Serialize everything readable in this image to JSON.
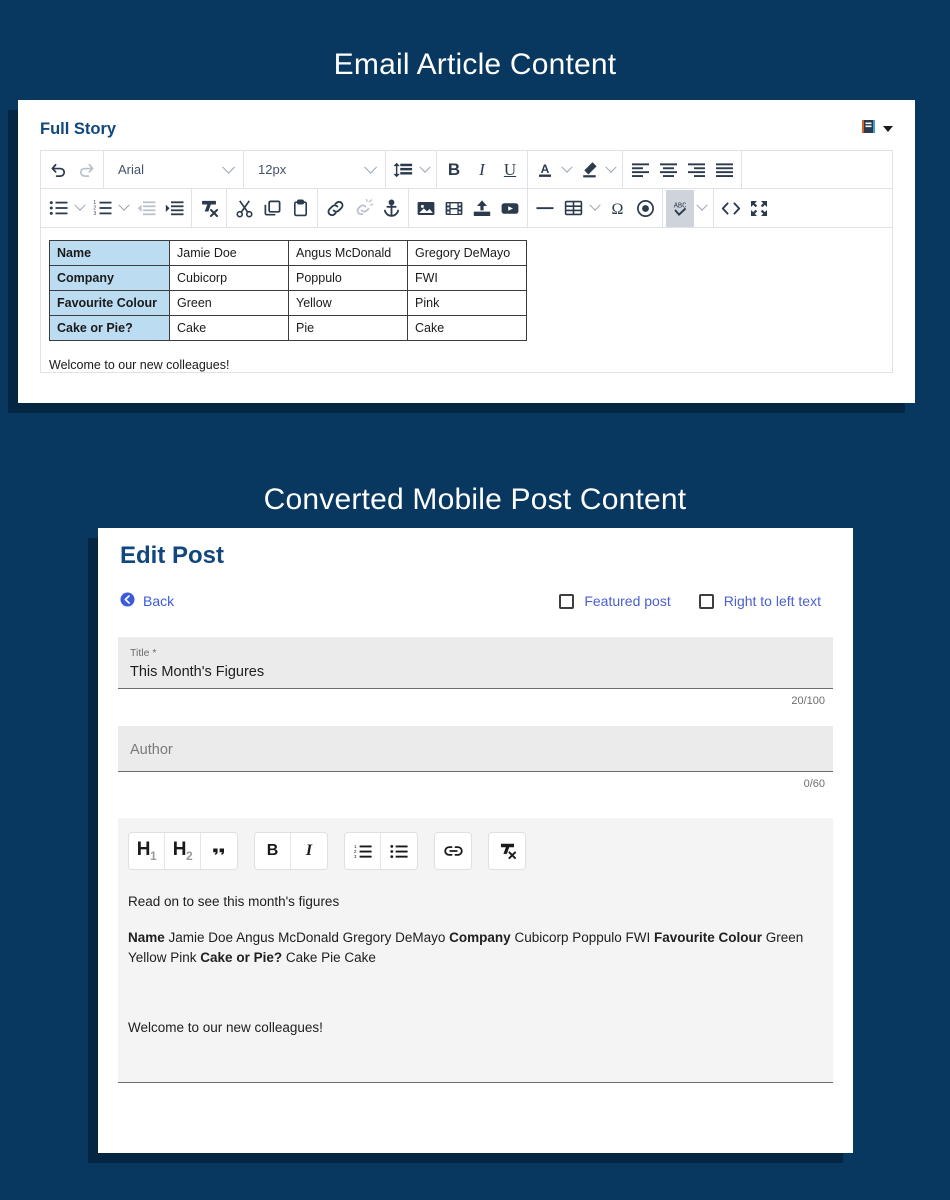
{
  "page": {
    "background_color": "#083760",
    "heading_email": "Email Article Content",
    "heading_mobile": "Converted Mobile Post Content"
  },
  "email_editor": {
    "panel_title": "Full Story",
    "header_menu_icon": "article-menu-icon",
    "toolbar_row1": {
      "undo": "undo-icon",
      "redo": "redo-icon",
      "font_family_value": "Arial",
      "font_size_value": "12px",
      "line_height": "line-height-icon",
      "bold": "B",
      "italic": "I",
      "underline": "U",
      "text_color": "A",
      "highlight": "highlight-pen-icon",
      "align_left": "align-left-icon",
      "align_center": "align-center-icon",
      "align_right": "align-right-icon",
      "align_justify": "align-justify-icon"
    },
    "toolbar_row2": {
      "bullet_list": "bullet-list-icon",
      "numbered_list": "numbered-list-icon",
      "outdent": "outdent-icon",
      "indent": "indent-icon",
      "clear_formatting": "clear-formatting-icon",
      "cut": "scissors-icon",
      "copy": "copy-icon",
      "paste": "paste-icon",
      "insert_link": "link-icon",
      "unlink": "unlink-icon",
      "anchor": "anchor-icon",
      "image": "image-icon",
      "video": "film-icon",
      "upload": "upload-icon",
      "youtube": "youtube-icon",
      "horizontal_rule": "horizontal-rule-icon",
      "table": "table-icon",
      "special_character": "omega-icon",
      "target": "target-icon",
      "spellcheck": "spellcheck-icon",
      "source_code": "code-icon",
      "fullscreen": "fullscreen-icon"
    },
    "content": {
      "table": {
        "rows": [
          {
            "header": "Name",
            "cells": [
              "Jamie Doe",
              "Angus McDonald",
              "Gregory DeMayo"
            ]
          },
          {
            "header": "Company",
            "cells": [
              "Cubicorp",
              "Poppulo",
              "FWI"
            ]
          },
          {
            "header": "Favourite Colour",
            "cells": [
              "Green",
              "Yellow",
              "Pink"
            ]
          },
          {
            "header": "Cake or Pie?",
            "cells": [
              "Cake",
              "Pie",
              "Cake"
            ]
          }
        ],
        "header_cell_color": "#bcdcf2"
      },
      "paragraph": "Welcome to our new colleagues!"
    }
  },
  "mobile_post": {
    "page_title": "Edit Post",
    "back_label": "Back",
    "back_icon": "back-arrow-icon",
    "checkboxes": [
      {
        "label": "Featured post",
        "checked": false
      },
      {
        "label": "Right to left text",
        "checked": false
      }
    ],
    "title_field": {
      "label": "Title *",
      "value": "This Month's Figures",
      "counter": "20/100"
    },
    "author_field": {
      "placeholder": "Author",
      "value": "",
      "counter": "0/60"
    },
    "editor_toolbar": [
      {
        "name": "heading-1-button",
        "label": "H",
        "sub": "1"
      },
      {
        "name": "heading-2-button",
        "label": "H",
        "sub": "2"
      },
      {
        "name": "blockquote-button",
        "label": "”",
        "sub": ""
      },
      {
        "name": "bold-button",
        "label": "B",
        "sub": ""
      },
      {
        "name": "italic-button",
        "label": "I",
        "sub": ""
      },
      {
        "name": "numbered-list-button",
        "label": "",
        "sub": ""
      },
      {
        "name": "bullet-list-button",
        "label": "",
        "sub": ""
      },
      {
        "name": "link-button",
        "label": "",
        "sub": ""
      },
      {
        "name": "clear-formatting-button",
        "label": "",
        "sub": ""
      }
    ],
    "body": {
      "p1": "Read on to see this month's figures",
      "p2_runs": [
        {
          "text": "Name",
          "bold": true
        },
        {
          "text": " Jamie Doe Angus McDonald Gregory DeMayo ",
          "bold": false
        },
        {
          "text": "Company",
          "bold": true
        },
        {
          "text": " Cubicorp Poppulo FWI ",
          "bold": false
        },
        {
          "text": "Favourite Colour",
          "bold": true
        },
        {
          "text": " Green Yellow Pink ",
          "bold": false
        },
        {
          "text": "Cake or Pie?",
          "bold": true
        },
        {
          "text": " Cake Pie Cake",
          "bold": false
        }
      ],
      "p3": "Welcome to our new colleagues!"
    }
  }
}
